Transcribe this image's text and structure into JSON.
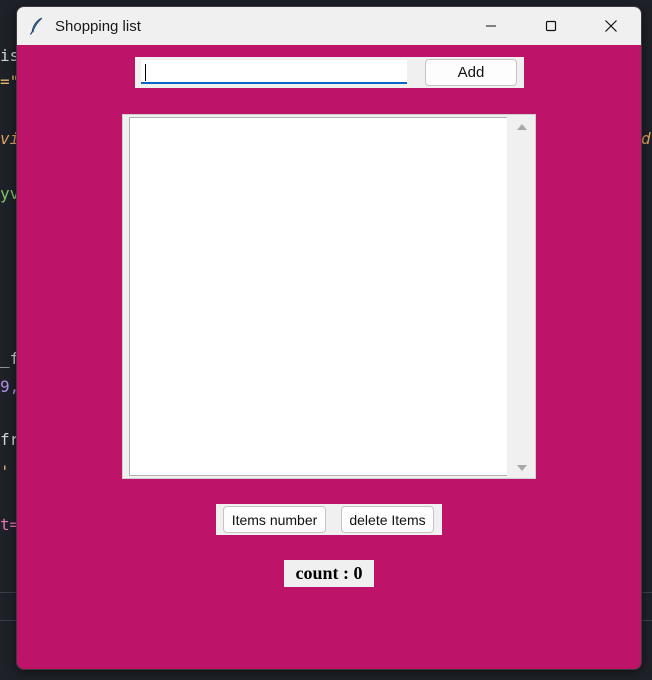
{
  "window": {
    "title": "Shopping list",
    "background": "#bd1368"
  },
  "titlebar": {
    "icon": "feather-icon",
    "minimize": "minimize-icon",
    "maximize": "maximize-icon",
    "close": "close-icon"
  },
  "entry": {
    "value": ""
  },
  "add_label": "Add",
  "buttons": {
    "items_number": "Items number",
    "delete_items": "delete Items"
  },
  "count": {
    "text": "count : 0"
  },
  "background_code": [
    "is",
    "=\"",
    "vi",
    "yv",
    "_f",
    "9,",
    "fr",
    "' ,",
    "t=",
    "d"
  ]
}
